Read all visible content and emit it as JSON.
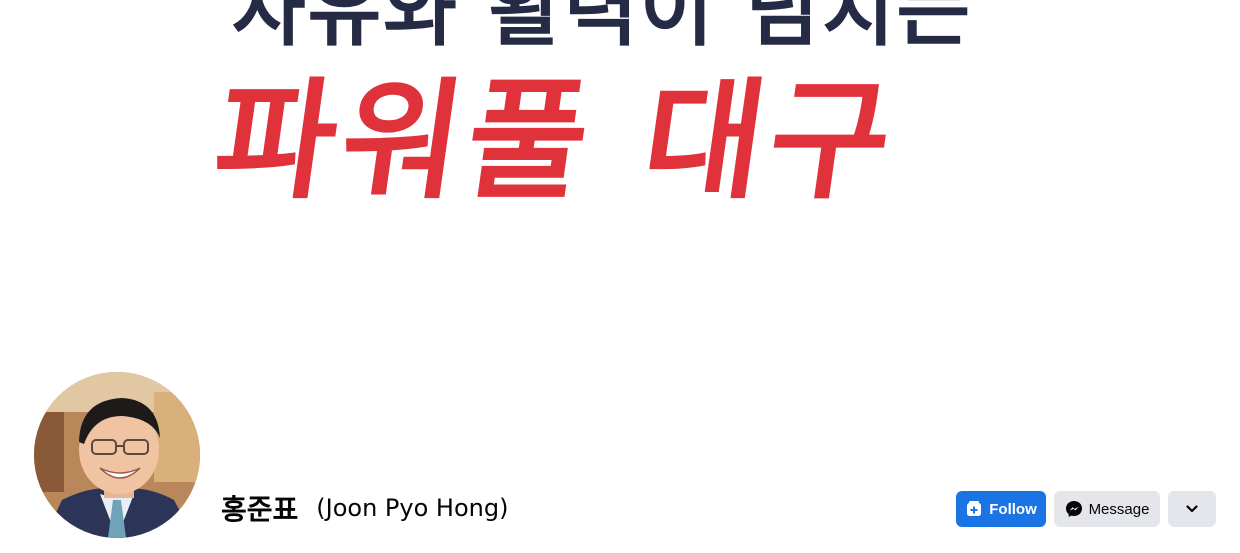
{
  "cover": {
    "line1": "자유와 활력이 넘치는",
    "line2": "파워풀 대구"
  },
  "profile": {
    "name_korean": "홍준표",
    "name_english": "(Joon Pyo Hong)"
  },
  "actions": {
    "follow_label": "Follow",
    "message_label": "Message"
  },
  "icons": {
    "follow": "follow-icon",
    "message": "messenger-icon",
    "more": "chevron-down-icon"
  },
  "colors": {
    "primary": "#1b74e4",
    "secondary_button": "#e4e6eb",
    "cover_navy": "#252a45",
    "cover_red": "#e0323a"
  }
}
